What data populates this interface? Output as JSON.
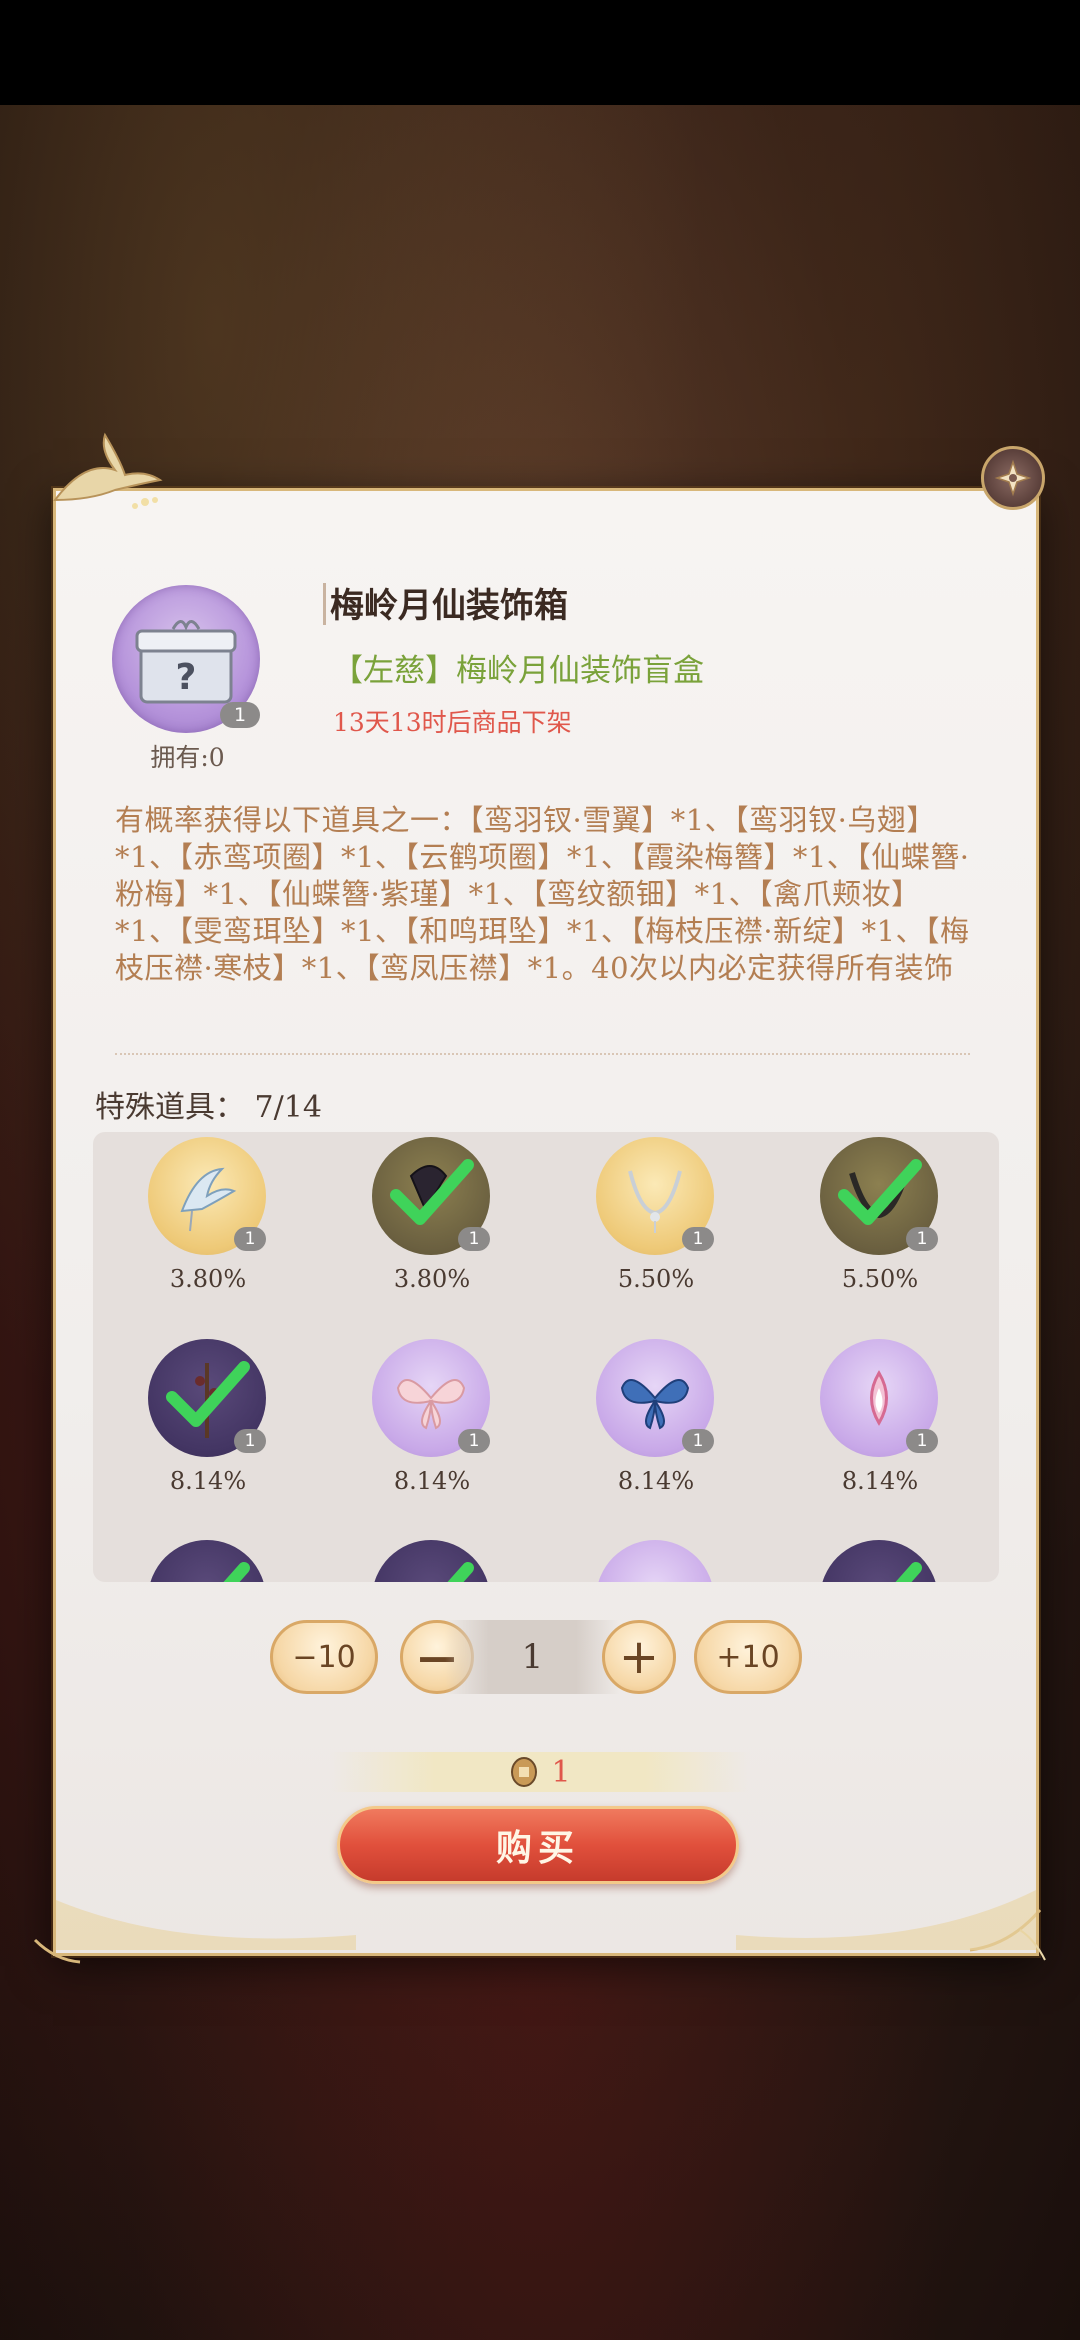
{
  "dialog": {
    "title": "梅岭月仙装饰箱",
    "subtitle": "【左慈】梅岭月仙装饰盲盒",
    "timer": "13天13时后商品下架",
    "owned_label": "拥有:0",
    "item_count": "1",
    "description": "有概率获得以下道具之一：【鸾羽钗·雪翼】*1、【鸾羽钗·乌翅】*1、【赤鸾项圈】*1、【云鹤项圈】*1、【霞染梅簪】*1、【仙蝶簪·粉梅】*1、【仙蝶簪·紫瑾】*1、【鸾纹额钿】*1、【禽爪颊妆】*1、【雯鸾珥坠】*1、【和鸣珥坠】*1、【梅枝压襟·新绽】*1、【梅枝压襟·寒枝】*1、【鸾凤压襟】*1。40次以内必定获得所有装饰",
    "special_label": "特殊道具：",
    "special_count": "7/14"
  },
  "items": [
    {
      "pct": "3.80%",
      "count": "1",
      "style": "gold",
      "checked": false,
      "icon": "hairpin-feather-icon"
    },
    {
      "pct": "3.80%",
      "count": "1",
      "style": "dark-gold",
      "checked": true,
      "icon": "hairpin-dark-icon"
    },
    {
      "pct": "5.50%",
      "count": "1",
      "style": "gold",
      "checked": false,
      "icon": "necklace-icon"
    },
    {
      "pct": "5.50%",
      "count": "1",
      "style": "dark-gold",
      "checked": true,
      "icon": "necklace-dark-icon"
    },
    {
      "pct": "8.14%",
      "count": "1",
      "style": "dark-purple",
      "checked": true,
      "icon": "plum-hairpin-icon"
    },
    {
      "pct": "8.14%",
      "count": "1",
      "style": "purple",
      "checked": false,
      "icon": "pink-butterfly-icon"
    },
    {
      "pct": "8.14%",
      "count": "1",
      "style": "purple",
      "checked": false,
      "icon": "blue-butterfly-icon"
    },
    {
      "pct": "8.14%",
      "count": "1",
      "style": "purple",
      "checked": false,
      "icon": "forehead-ornament-icon"
    },
    {
      "pct": "",
      "count": "",
      "style": "dark-purple",
      "checked": true,
      "icon": "partial-item-icon"
    },
    {
      "pct": "",
      "count": "",
      "style": "dark-purple",
      "checked": true,
      "icon": "partial-item-icon"
    },
    {
      "pct": "",
      "count": "",
      "style": "purple",
      "checked": false,
      "icon": "partial-item-icon"
    },
    {
      "pct": "",
      "count": "",
      "style": "dark-purple",
      "checked": true,
      "icon": "partial-item-icon"
    }
  ],
  "quantity": {
    "minus10": "−10",
    "minus": "—",
    "value": "1",
    "plus": "+",
    "plus10": "+10"
  },
  "price": {
    "value": "1",
    "icon": "coin-icon"
  },
  "buy_label": "购买",
  "colors": {
    "accent_red": "#e0574b",
    "subtitle_green": "#7aa23a",
    "gold_border": "#d8b77a"
  }
}
